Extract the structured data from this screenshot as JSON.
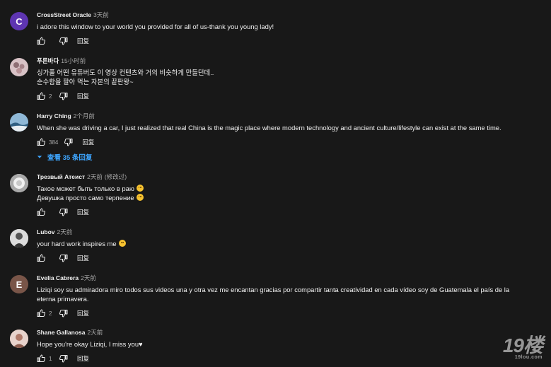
{
  "comments": [
    {
      "author": "CrossStreet Oracle",
      "time": "3天前",
      "avatar_letter": "C",
      "avatar_color": "#5e35b1",
      "lines": [
        "i adore this window to your world you provided for all of us-thank you young lady!"
      ],
      "likes": "",
      "reply_label": "回复"
    },
    {
      "author": "푸른바다",
      "time": "15小时前",
      "avatar_letter": "",
      "avatar_color": "#d8c2c6",
      "lines": [
        "싱가풀 어떤 유튜버도 이 영상  컨텐츠와 거의 비슷하게 만들던데..",
        "순수함을 팔아 먹는 자본의 끝판왕~"
      ],
      "likes": "2",
      "reply_label": "回复"
    },
    {
      "author": "Harry Ching",
      "time": "2个月前",
      "avatar_letter": "",
      "avatar_color": "#4a7fa5",
      "lines": [
        "When she was driving a car, I just realized that real China is the magic place where modern technology and ancient culture/lifestyle can exist at the same time."
      ],
      "likes": "384",
      "reply_label": "回复",
      "view_replies": "查看 35 条回复"
    },
    {
      "author": "Трезвый Атеист",
      "time": "2天前",
      "edited": "(修改过)",
      "avatar_letter": "",
      "avatar_color": "#cfcfcf",
      "lines": [
        "Такое может быть только в раю",
        "Девушка просто само терпение"
      ],
      "likes": "",
      "reply_label": "回复"
    },
    {
      "author": "Lubov",
      "time": "2天前",
      "avatar_letter": "",
      "avatar_color": "#e9e9e9",
      "lines": [
        "your hard work inspires me"
      ],
      "likes": "",
      "reply_label": "回复"
    },
    {
      "author": "Evelia Cabrera",
      "time": "2天前",
      "avatar_letter": "E",
      "avatar_color": "#795548",
      "lines": [
        "Liziqi soy su admiradora miro todos sus videos una y otra vez me encantan gracias por compartir tanta creatividad en cada vídeo soy de Guatemala el país de la eterna primavera."
      ],
      "likes": "2",
      "reply_label": "回复"
    },
    {
      "author": "Shane Gallanosa",
      "time": "2天前",
      "avatar_letter": "",
      "avatar_color": "#c9a090",
      "lines": [
        "Hope you're okay Liziqi, I miss you♥"
      ],
      "likes": "1",
      "reply_label": "回复"
    }
  ],
  "watermark": {
    "main": "19楼",
    "sub": "19lou.com"
  }
}
